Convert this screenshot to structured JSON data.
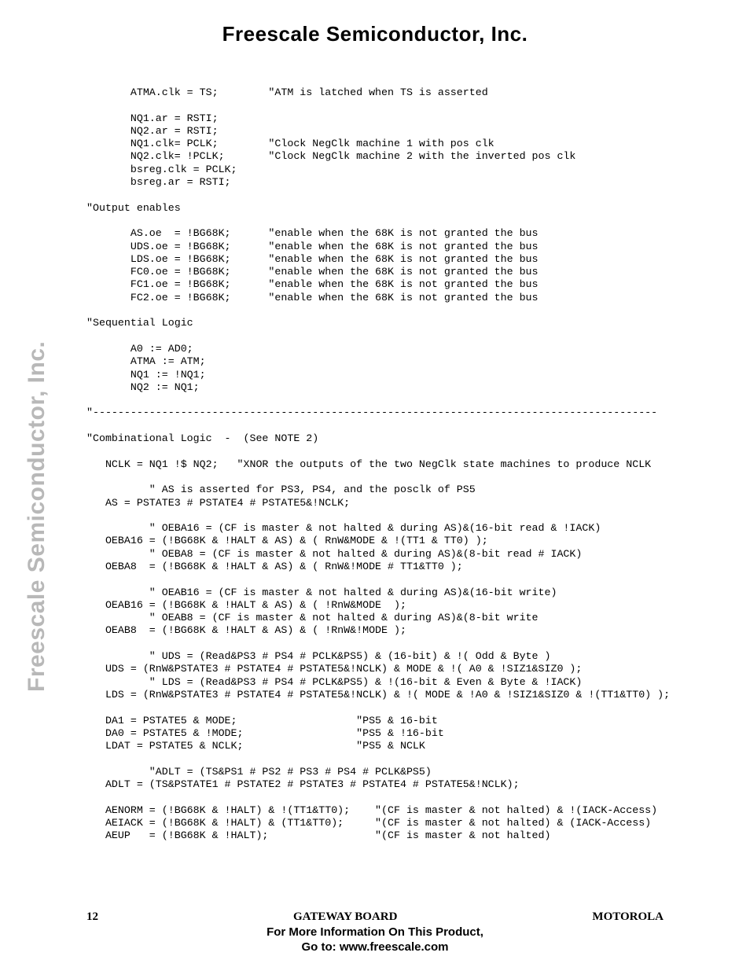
{
  "header": {
    "company": "Freescale Semiconductor, Inc."
  },
  "sidebar": {
    "text": "Freescale Semiconductor, Inc."
  },
  "code": {
    "text": "       ATMA.clk = TS;        \"ATM is latched when TS is asserted\n\n       NQ1.ar = RSTI;\n       NQ2.ar = RSTI;\n       NQ1.clk= PCLK;        \"Clock NegClk machine 1 with pos clk\n       NQ2.clk= !PCLK;       \"Clock NegClk machine 2 with the inverted pos clk\n       bsreg.clk = PCLK;\n       bsreg.ar = RSTI;\n\n\"Output enables\n\n       AS.oe  = !BG68K;      \"enable when the 68K is not granted the bus\n       UDS.oe = !BG68K;      \"enable when the 68K is not granted the bus\n       LDS.oe = !BG68K;      \"enable when the 68K is not granted the bus\n       FC0.oe = !BG68K;      \"enable when the 68K is not granted the bus\n       FC1.oe = !BG68K;      \"enable when the 68K is not granted the bus\n       FC2.oe = !BG68K;      \"enable when the 68K is not granted the bus\n\n\"Sequential Logic\n\n       A0 := AD0;\n       ATMA := ATM;\n       NQ1 := !NQ1;\n       NQ2 := NQ1;\n\n\"------------------------------------------------------------------------------------------\n\n\"Combinational Logic  -  (See NOTE 2)\n\n   NCLK = NQ1 !$ NQ2;   \"XNOR the outputs of the two NegClk state machines to produce NCLK\n\n          \" AS is asserted for PS3, PS4, and the posclk of PS5\n   AS = PSTATE3 # PSTATE4 # PSTATE5&!NCLK;\n\n          \" OEBA16 = (CF is master & not halted & during AS)&(16-bit read & !IACK)\n   OEBA16 = (!BG68K & !HALT & AS) & ( RnW&MODE & !(TT1 & TT0) );\n          \" OEBA8 = (CF is master & not halted & during AS)&(8-bit read # IACK)\n   OEBA8  = (!BG68K & !HALT & AS) & ( RnW&!MODE # TT1&TT0 );\n\n          \" OEAB16 = (CF is master & not halted & during AS)&(16-bit write)\n   OEAB16 = (!BG68K & !HALT & AS) & ( !RnW&MODE  );\n          \" OEAB8 = (CF is master & not halted & during AS)&(8-bit write\n   OEAB8  = (!BG68K & !HALT & AS) & ( !RnW&!MODE );\n\n          \" UDS = (Read&PS3 # PS4 # PCLK&PS5) & (16-bit) & !( Odd & Byte )\n   UDS = (RnW&PSTATE3 # PSTATE4 # PSTATE5&!NCLK) & MODE & !( A0 & !SIZ1&SIZ0 );\n          \" LDS = (Read&PS3 # PS4 # PCLK&PS5) & !(16-bit & Even & Byte & !IACK)\n   LDS = (RnW&PSTATE3 # PSTATE4 # PSTATE5&!NCLK) & !( MODE & !A0 & !SIZ1&SIZ0 & !(TT1&TT0) );\n\n   DA1 = PSTATE5 & MODE;                   \"PS5 & 16-bit\n   DA0 = PSTATE5 & !MODE;                  \"PS5 & !16-bit\n   LDAT = PSTATE5 & NCLK;                  \"PS5 & NCLK\n\n          \"ADLT = (TS&PS1 # PS2 # PS3 # PS4 # PCLK&PS5)\n   ADLT = (TS&PSTATE1 # PSTATE2 # PSTATE3 # PSTATE4 # PSTATE5&!NCLK);\n\n   AENORM = (!BG68K & !HALT) & !(TT1&TT0);    \"(CF is master & not halted) & !(IACK-Access)\n   AEIACK = (!BG68K & !HALT) & (TT1&TT0);     \"(CF is master & not halted) & (IACK-Access)\n   AEUP   = (!BG68K & !HALT);                 \"(CF is master & not halted)"
  },
  "footer": {
    "page_number": "12",
    "title": "GATEWAY BOARD",
    "brand": "MOTOROLA",
    "line1": "For More Information On This Product,",
    "line2": "Go to: www.freescale.com"
  }
}
